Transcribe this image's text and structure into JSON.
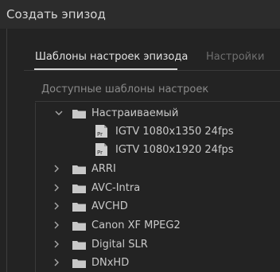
{
  "window": {
    "title": "Создать эпизод"
  },
  "tabs": [
    {
      "label": "Шаблоны настроек эпизода",
      "active": true
    },
    {
      "label": "Настройки",
      "active": false
    }
  ],
  "section_label": "Доступные шаблоны настроек",
  "tree": {
    "items": [
      {
        "label": "Настраиваемый",
        "type": "folder",
        "expanded": true,
        "icon": "folder-icon"
      },
      {
        "label": "IGTV 1080x1350 24fps",
        "type": "preset",
        "icon": "preset-file-icon"
      },
      {
        "label": "IGTV 1080x1920 24fps",
        "type": "preset",
        "icon": "preset-file-icon"
      },
      {
        "label": "ARRI",
        "type": "folder",
        "expanded": false,
        "icon": "folder-icon"
      },
      {
        "label": "AVC-Intra",
        "type": "folder",
        "expanded": false,
        "icon": "folder-icon"
      },
      {
        "label": "AVCHD",
        "type": "folder",
        "expanded": false,
        "icon": "folder-icon"
      },
      {
        "label": "Canon XF MPEG2",
        "type": "folder",
        "expanded": false,
        "icon": "folder-icon"
      },
      {
        "label": "Digital SLR",
        "type": "folder",
        "expanded": false,
        "icon": "folder-icon"
      },
      {
        "label": "DNxHD",
        "type": "folder",
        "expanded": false,
        "icon": "folder-icon"
      }
    ]
  },
  "colors": {
    "background": "#232323",
    "titlebar": "#2c2c2c",
    "text": "#c9c9c9",
    "muted_text": "#6f6f6f",
    "folder": "#c8c8c8"
  }
}
